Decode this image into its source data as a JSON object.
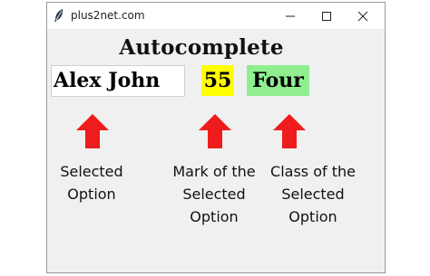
{
  "window": {
    "title": "plus2net.com",
    "icons": {
      "app": "feather-icon",
      "minimize": "minimize-icon",
      "maximize": "maximize-icon",
      "close": "close-icon"
    }
  },
  "main": {
    "heading": "Autocomplete",
    "entry_value": "Alex John",
    "mark_value": "55",
    "class_value": "Four"
  },
  "colors": {
    "mark_background": "#ffff00",
    "class_background": "#90ee90",
    "arrow": "#ee1c1c"
  },
  "annotations": [
    {
      "icon": "arrow-up-icon",
      "lines": [
        "Selected",
        "Option"
      ]
    },
    {
      "icon": "arrow-up-icon",
      "lines": [
        "Mark of the",
        "Selected",
        "Option"
      ]
    },
    {
      "icon": "arrow-up-icon",
      "lines": [
        "Class of the",
        "Selected",
        "Option"
      ]
    }
  ]
}
